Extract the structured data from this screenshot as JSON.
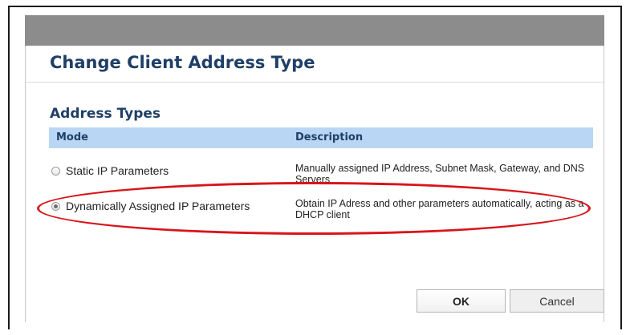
{
  "dialog": {
    "title": "Change Client Address Type",
    "section_title": "Address Types"
  },
  "table": {
    "columns": [
      "Mode",
      "Description"
    ],
    "rows": [
      {
        "mode": "Static IP Parameters",
        "description": "Manually assigned IP Address, Subnet Mask, Gateway, and DNS Servers",
        "selected": false
      },
      {
        "mode": "Dynamically Assigned IP Parameters",
        "description": "Obtain IP Adress and other parameters automatically, acting as a DHCP client",
        "selected": true
      }
    ]
  },
  "buttons": {
    "ok": "OK",
    "cancel": "Cancel"
  },
  "colors": {
    "title": "#1f3f66",
    "header_bg": "#b9d7f5",
    "highlight": "#d8151b",
    "overlay": "#8c8c8c"
  }
}
